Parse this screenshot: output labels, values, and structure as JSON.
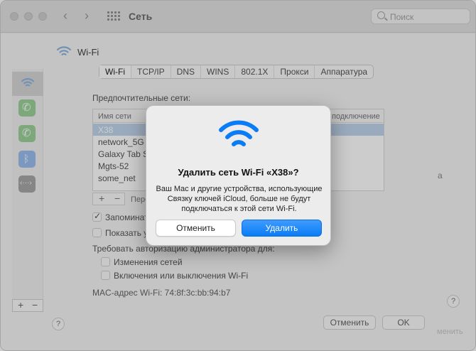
{
  "window": {
    "title": "Сеть",
    "search_placeholder": "Поиск"
  },
  "service_header": "Wi-Fi",
  "tabs": [
    {
      "label": "Wi-Fi",
      "active": true
    },
    {
      "label": "TCP/IP",
      "active": false
    },
    {
      "label": "DNS",
      "active": false
    },
    {
      "label": "WINS",
      "active": false
    },
    {
      "label": "802.1X",
      "active": false
    },
    {
      "label": "Прокси",
      "active": false
    },
    {
      "label": "Аппаратура",
      "active": false
    }
  ],
  "preferred": {
    "label": "Предпочтительные сети:",
    "col_name": "Имя сети",
    "col_connection": "подключение",
    "rows": [
      "X38",
      "network_5G",
      "Galaxy Tab S",
      "Mgts-52",
      "some_net"
    ],
    "selected_row": "X38",
    "plus": "+",
    "minus": "−",
    "pm_label": "Пере"
  },
  "checkboxes": {
    "remember": "Запоминат",
    "show": "Показать у",
    "admin_label": "Требовать авторизацию администратора для:",
    "change_networks": "Изменения сетей",
    "toggle_wifi": "Включения или выключения Wi-Fi"
  },
  "mac_address": "MAC-адрес Wi-Fi:  74:8f:3c:bb:94:b7",
  "bottom": {
    "help": "?",
    "cancel": "Отменить",
    "ok": "OK",
    "apply": "менить",
    "side_char": "а"
  },
  "sidebar": {
    "plus": "+",
    "minus": "−"
  },
  "dialog": {
    "title": "Удалить сеть Wi-Fi «X38»?",
    "message": "Ваш Mac и другие устройства, использующие Связку ключей iCloud, больше не будут подключаться к этой сети Wi-Fi.",
    "cancel_label": "Отменить",
    "delete_label": "Удалить",
    "icon_color": "#0a7cf5"
  }
}
